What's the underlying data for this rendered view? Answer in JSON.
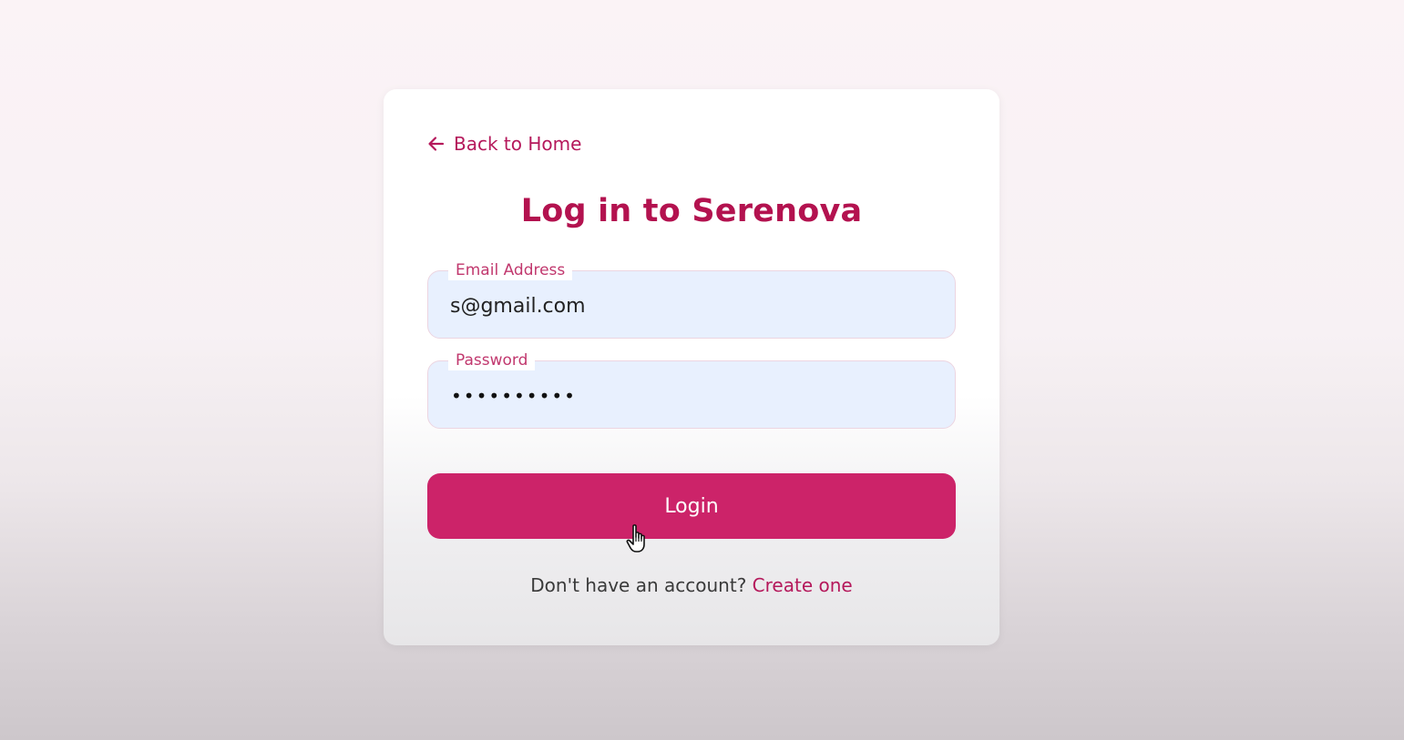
{
  "card": {
    "back_label": "Back to Home",
    "title": "Log in to Serenova"
  },
  "form": {
    "email": {
      "label": "Email Address",
      "value": "s@gmail.com"
    },
    "password": {
      "label": "Password",
      "masked_value": "••••••••••"
    },
    "submit_label": "Login"
  },
  "footer": {
    "prompt": "Don't have an account?",
    "link_label": "Create one"
  },
  "icons": {
    "back": "arrow-left-icon",
    "cursor": "hand-pointer-icon"
  },
  "colors": {
    "accent": "#cc2369",
    "title": "#b3124f",
    "input_bg": "#e8f0fe"
  }
}
